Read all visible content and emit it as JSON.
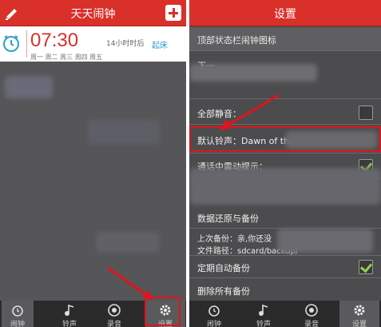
{
  "left": {
    "header": {
      "title": "天天闹钟"
    },
    "alarm": {
      "time": "07:30",
      "remaining": "14小时时后",
      "days": "周一 周二 周三 周四 周五",
      "wake_label": "起床"
    },
    "tabs": [
      {
        "label": "闹钟",
        "icon": "alarm-clock-icon"
      },
      {
        "label": "铃声",
        "icon": "music-note-icon"
      },
      {
        "label": "录音",
        "icon": "record-icon"
      },
      {
        "label": "设置",
        "icon": "gear-icon",
        "active": true
      }
    ]
  },
  "right": {
    "header": {
      "title": "设置"
    },
    "rows": {
      "status_bar_icon": "顶部状态栏闹钟图标",
      "partial_row": "下一",
      "mute_all": "全部静音：",
      "default_ringtone": "默认铃声：Dawn of the",
      "vibrate_on_call": "通话中震动提示：",
      "restore_backup": "数据还原与备份",
      "last_backup": "上次备份：亲,你还没",
      "file_path": "文件路径：sdcard/backup/",
      "auto_backup": "定期自动备份",
      "delete_backups": "删除所有备份"
    },
    "checkboxes": {
      "mute_all": false,
      "vibrate_on_call": true,
      "auto_backup": true
    },
    "tabs": [
      {
        "label": "闹钟",
        "icon": "alarm-clock-icon"
      },
      {
        "label": "铃声",
        "icon": "music-note-icon"
      },
      {
        "label": "录音",
        "icon": "record-icon"
      },
      {
        "label": "设置",
        "icon": "gear-icon",
        "active": true
      }
    ]
  },
  "colors": {
    "brand_red": "#d9302a",
    "highlight_red": "#e0141b",
    "check_green": "#8fd14f"
  }
}
